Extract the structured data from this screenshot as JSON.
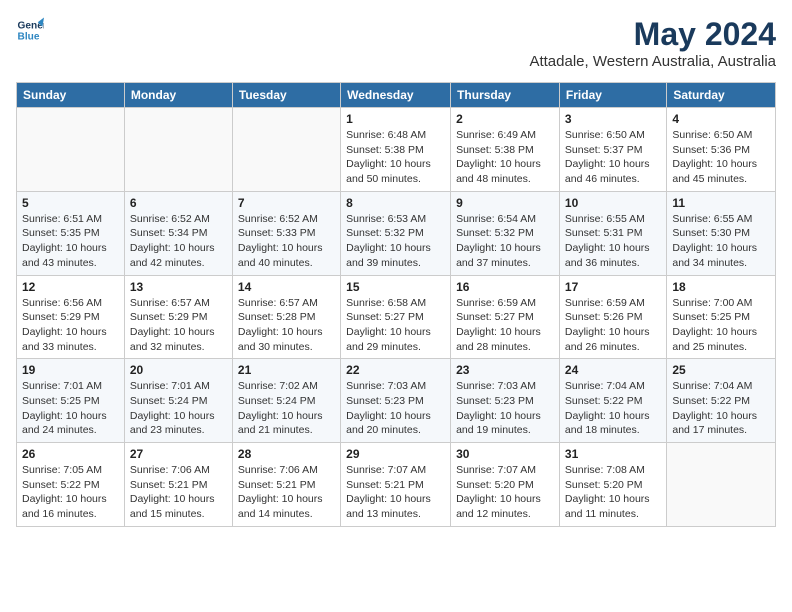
{
  "logo": {
    "line1": "General",
    "line2": "Blue"
  },
  "title": "May 2024",
  "subtitle": "Attadale, Western Australia, Australia",
  "headers": [
    "Sunday",
    "Monday",
    "Tuesday",
    "Wednesday",
    "Thursday",
    "Friday",
    "Saturday"
  ],
  "weeks": [
    [
      {
        "num": "",
        "info": ""
      },
      {
        "num": "",
        "info": ""
      },
      {
        "num": "",
        "info": ""
      },
      {
        "num": "1",
        "info": "Sunrise: 6:48 AM\nSunset: 5:38 PM\nDaylight: 10 hours\nand 50 minutes."
      },
      {
        "num": "2",
        "info": "Sunrise: 6:49 AM\nSunset: 5:38 PM\nDaylight: 10 hours\nand 48 minutes."
      },
      {
        "num": "3",
        "info": "Sunrise: 6:50 AM\nSunset: 5:37 PM\nDaylight: 10 hours\nand 46 minutes."
      },
      {
        "num": "4",
        "info": "Sunrise: 6:50 AM\nSunset: 5:36 PM\nDaylight: 10 hours\nand 45 minutes."
      }
    ],
    [
      {
        "num": "5",
        "info": "Sunrise: 6:51 AM\nSunset: 5:35 PM\nDaylight: 10 hours\nand 43 minutes."
      },
      {
        "num": "6",
        "info": "Sunrise: 6:52 AM\nSunset: 5:34 PM\nDaylight: 10 hours\nand 42 minutes."
      },
      {
        "num": "7",
        "info": "Sunrise: 6:52 AM\nSunset: 5:33 PM\nDaylight: 10 hours\nand 40 minutes."
      },
      {
        "num": "8",
        "info": "Sunrise: 6:53 AM\nSunset: 5:32 PM\nDaylight: 10 hours\nand 39 minutes."
      },
      {
        "num": "9",
        "info": "Sunrise: 6:54 AM\nSunset: 5:32 PM\nDaylight: 10 hours\nand 37 minutes."
      },
      {
        "num": "10",
        "info": "Sunrise: 6:55 AM\nSunset: 5:31 PM\nDaylight: 10 hours\nand 36 minutes."
      },
      {
        "num": "11",
        "info": "Sunrise: 6:55 AM\nSunset: 5:30 PM\nDaylight: 10 hours\nand 34 minutes."
      }
    ],
    [
      {
        "num": "12",
        "info": "Sunrise: 6:56 AM\nSunset: 5:29 PM\nDaylight: 10 hours\nand 33 minutes."
      },
      {
        "num": "13",
        "info": "Sunrise: 6:57 AM\nSunset: 5:29 PM\nDaylight: 10 hours\nand 32 minutes."
      },
      {
        "num": "14",
        "info": "Sunrise: 6:57 AM\nSunset: 5:28 PM\nDaylight: 10 hours\nand 30 minutes."
      },
      {
        "num": "15",
        "info": "Sunrise: 6:58 AM\nSunset: 5:27 PM\nDaylight: 10 hours\nand 29 minutes."
      },
      {
        "num": "16",
        "info": "Sunrise: 6:59 AM\nSunset: 5:27 PM\nDaylight: 10 hours\nand 28 minutes."
      },
      {
        "num": "17",
        "info": "Sunrise: 6:59 AM\nSunset: 5:26 PM\nDaylight: 10 hours\nand 26 minutes."
      },
      {
        "num": "18",
        "info": "Sunrise: 7:00 AM\nSunset: 5:25 PM\nDaylight: 10 hours\nand 25 minutes."
      }
    ],
    [
      {
        "num": "19",
        "info": "Sunrise: 7:01 AM\nSunset: 5:25 PM\nDaylight: 10 hours\nand 24 minutes."
      },
      {
        "num": "20",
        "info": "Sunrise: 7:01 AM\nSunset: 5:24 PM\nDaylight: 10 hours\nand 23 minutes."
      },
      {
        "num": "21",
        "info": "Sunrise: 7:02 AM\nSunset: 5:24 PM\nDaylight: 10 hours\nand 21 minutes."
      },
      {
        "num": "22",
        "info": "Sunrise: 7:03 AM\nSunset: 5:23 PM\nDaylight: 10 hours\nand 20 minutes."
      },
      {
        "num": "23",
        "info": "Sunrise: 7:03 AM\nSunset: 5:23 PM\nDaylight: 10 hours\nand 19 minutes."
      },
      {
        "num": "24",
        "info": "Sunrise: 7:04 AM\nSunset: 5:22 PM\nDaylight: 10 hours\nand 18 minutes."
      },
      {
        "num": "25",
        "info": "Sunrise: 7:04 AM\nSunset: 5:22 PM\nDaylight: 10 hours\nand 17 minutes."
      }
    ],
    [
      {
        "num": "26",
        "info": "Sunrise: 7:05 AM\nSunset: 5:22 PM\nDaylight: 10 hours\nand 16 minutes."
      },
      {
        "num": "27",
        "info": "Sunrise: 7:06 AM\nSunset: 5:21 PM\nDaylight: 10 hours\nand 15 minutes."
      },
      {
        "num": "28",
        "info": "Sunrise: 7:06 AM\nSunset: 5:21 PM\nDaylight: 10 hours\nand 14 minutes."
      },
      {
        "num": "29",
        "info": "Sunrise: 7:07 AM\nSunset: 5:21 PM\nDaylight: 10 hours\nand 13 minutes."
      },
      {
        "num": "30",
        "info": "Sunrise: 7:07 AM\nSunset: 5:20 PM\nDaylight: 10 hours\nand 12 minutes."
      },
      {
        "num": "31",
        "info": "Sunrise: 7:08 AM\nSunset: 5:20 PM\nDaylight: 10 hours\nand 11 minutes."
      },
      {
        "num": "",
        "info": ""
      }
    ]
  ]
}
